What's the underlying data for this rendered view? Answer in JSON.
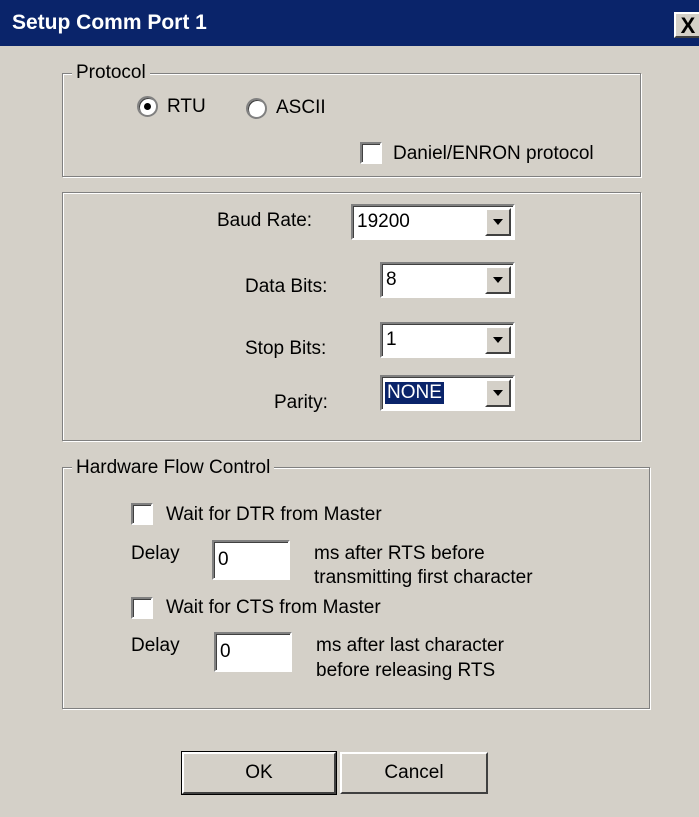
{
  "window": {
    "title": "Setup Comm Port 1",
    "close_glyph": "X"
  },
  "protocol": {
    "legend": "Protocol",
    "rtu_label": "RTU",
    "ascii_label": "ASCII",
    "selected": "RTU",
    "daniel_label": "Daniel/ENRON protocol",
    "daniel_checked": false
  },
  "serial": {
    "baud_label": "Baud Rate:",
    "baud_value": "19200",
    "data_bits_label": "Data Bits:",
    "data_bits_value": "8",
    "stop_bits_label": "Stop Bits:",
    "stop_bits_value": "1",
    "parity_label": "Parity:",
    "parity_value": "NONE"
  },
  "flow": {
    "legend": "Hardware Flow Control",
    "dtr_label": "Wait for DTR from Master",
    "dtr_checked": false,
    "delay1_label": "Delay",
    "delay1_value": "0",
    "delay1_desc_line1": "ms after RTS before",
    "delay1_desc_line2": "transmitting first character",
    "cts_label": "Wait for CTS from Master",
    "cts_checked": false,
    "delay2_label": "Delay",
    "delay2_value": "0",
    "delay2_desc_line1": "ms after last character",
    "delay2_desc_line2": "before releasing RTS"
  },
  "buttons": {
    "ok": "OK",
    "cancel": "Cancel"
  }
}
